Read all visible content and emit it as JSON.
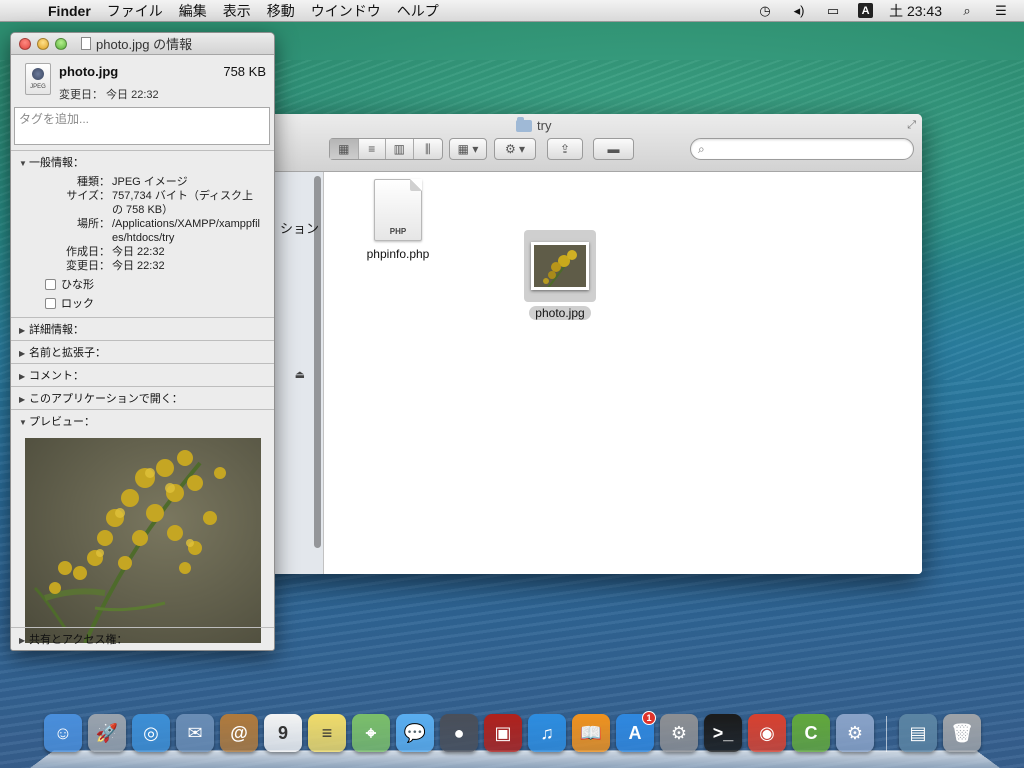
{
  "menubar": {
    "apple": "",
    "app": "Finder",
    "items": [
      "ファイル",
      "編集",
      "表示",
      "移動",
      "ウインドウ",
      "ヘルプ"
    ],
    "input_mode": "A",
    "clock": "土 23:43"
  },
  "finder": {
    "title": "try",
    "sidebar_partial": "ション",
    "search_placeholder": "",
    "files": [
      {
        "name": "phpinfo.php",
        "type_tag": "PHP",
        "selected": false
      },
      {
        "name": "photo.jpg",
        "selected": true
      }
    ]
  },
  "info": {
    "title": "photo.jpg の情報",
    "icon_tag": "JPEG",
    "filename": "photo.jpg",
    "size": "758 KB",
    "modified_header": "変更日： 今日 22:32",
    "tag_placeholder": "タグを追加...",
    "sections": {
      "general": "一般情報：",
      "more_info": "詳細情報：",
      "name_ext": "名前と拡張子：",
      "comments": "コメント：",
      "open_with": "このアプリケーションで開く：",
      "preview": "プレビュー：",
      "sharing": "共有とアクセス権："
    },
    "general": {
      "kind_label": "種類：",
      "kind": "JPEG イメージ",
      "size_label": "サイズ：",
      "size": "757,734 バイト（ディスク上の 758 KB）",
      "where_label": "場所：",
      "where": "/Applications/XAMPP/xamppfiles/htdocs/try",
      "created_label": "作成日：",
      "created": "今日 22:32",
      "modified_label": "変更日：",
      "modified": "今日 22:32",
      "stationery": "ひな形",
      "locked": "ロック"
    }
  },
  "dock": {
    "apps": [
      {
        "name": "finder",
        "color": "#4a8fdc",
        "glyph": "☺"
      },
      {
        "name": "launchpad",
        "color": "#9aa3ad",
        "glyph": "🚀"
      },
      {
        "name": "safari",
        "color": "#3d8fd6",
        "glyph": "◎"
      },
      {
        "name": "mail",
        "color": "#6a8db5",
        "glyph": "✉"
      },
      {
        "name": "contacts",
        "color": "#b07a3c",
        "glyph": "@"
      },
      {
        "name": "calendar",
        "color": "#f4f4f4",
        "glyph": "9"
      },
      {
        "name": "notes",
        "color": "#f1dc6a",
        "glyph": "≡"
      },
      {
        "name": "maps",
        "color": "#7bbf6a",
        "glyph": "⌖"
      },
      {
        "name": "messages",
        "color": "#5aaef0",
        "glyph": "💬"
      },
      {
        "name": "facetime",
        "color": "#4a4f59",
        "glyph": "●"
      },
      {
        "name": "photobooth",
        "color": "#b0211c",
        "glyph": "▣"
      },
      {
        "name": "itunes",
        "color": "#2d8de0",
        "glyph": "♫"
      },
      {
        "name": "ibooks",
        "color": "#f0921e",
        "glyph": "📖"
      },
      {
        "name": "appstore",
        "color": "#2f88e0",
        "glyph": "A",
        "badge": "1"
      },
      {
        "name": "system-preferences",
        "color": "#8d8f93",
        "glyph": "⚙"
      },
      {
        "name": "terminal",
        "color": "#1b1b1b",
        "glyph": ">_"
      },
      {
        "name": "chrome",
        "color": "#d9412f",
        "glyph": "◉"
      },
      {
        "name": "coda",
        "color": "#62a83b",
        "glyph": "C"
      },
      {
        "name": "utility",
        "color": "#8aa3c8",
        "glyph": "⚙"
      }
    ],
    "stack": {
      "name": "documents-stack",
      "color": "#5b84a3",
      "glyph": "▤"
    },
    "trash": {
      "name": "trash",
      "color": "#9fa3a8",
      "glyph": "🗑"
    }
  }
}
